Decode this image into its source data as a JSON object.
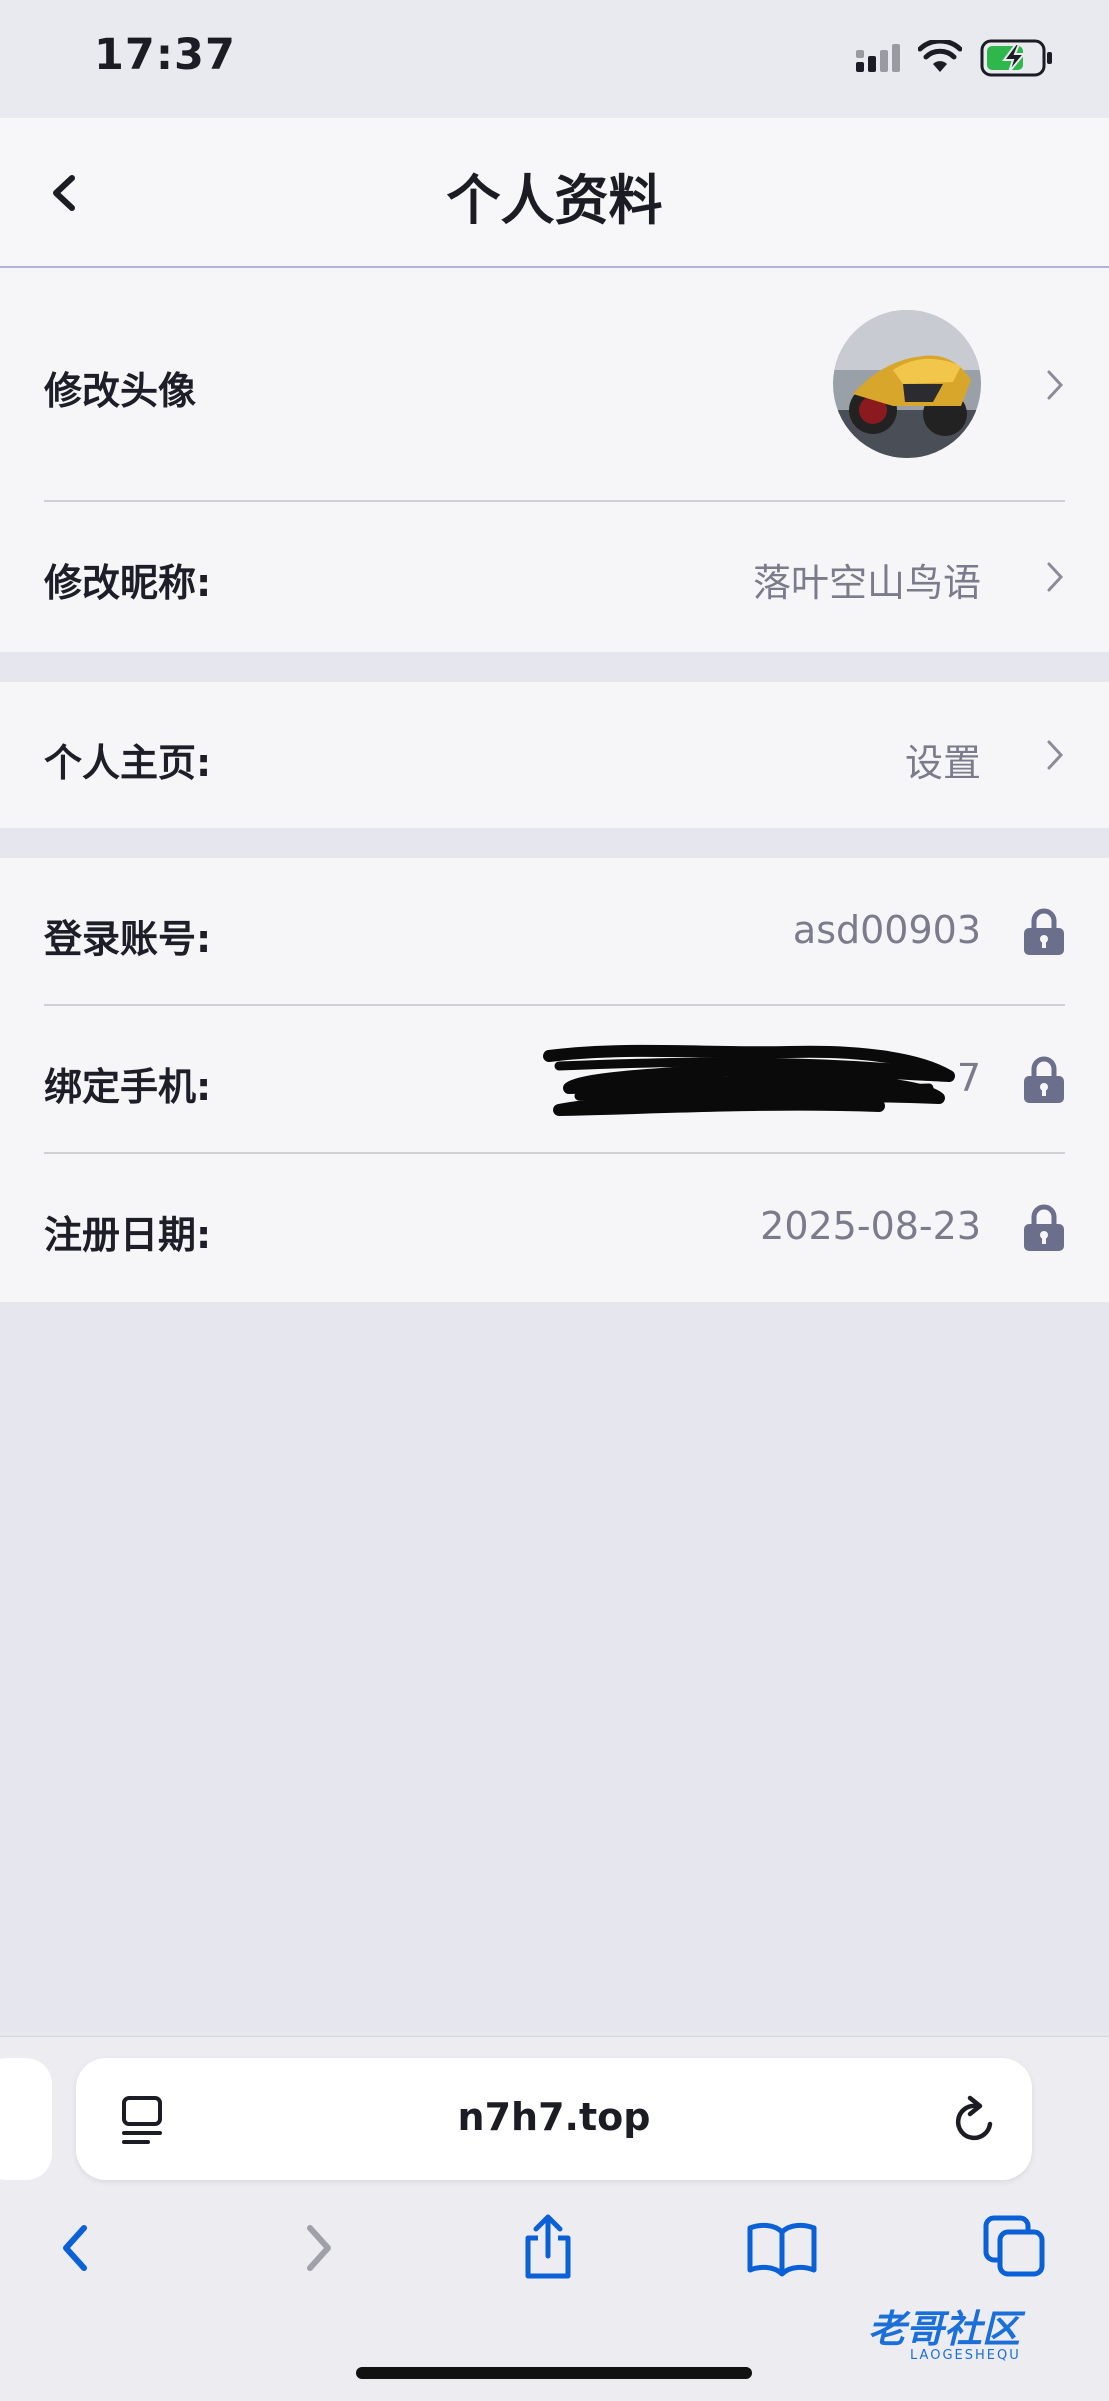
{
  "status_bar": {
    "time": "17:37"
  },
  "header": {
    "title": "个人资料"
  },
  "profile": {
    "avatar_label": "修改头像",
    "nickname_label": "修改昵称:",
    "nickname_value": "落叶空山鸟语"
  },
  "homepage": {
    "label": "个人主页:",
    "value": "设置"
  },
  "account": {
    "login_label": "登录账号:",
    "login_value": "asd00903",
    "phone_label": "绑定手机:",
    "phone_value_tail": "7",
    "register_label": "注册日期:",
    "register_value": "2025-08-23"
  },
  "browser": {
    "url": "n7h7.top"
  },
  "watermark": {
    "text": "老哥社区",
    "sub": "LAOGESHEQU"
  },
  "colors": {
    "accent": "#0a60d6",
    "lock": "#6b6f8c",
    "chevron": "#8b8b99"
  }
}
